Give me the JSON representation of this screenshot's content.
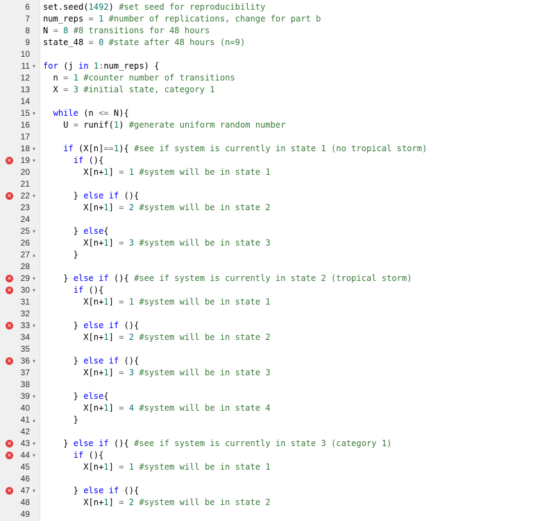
{
  "lines": [
    {
      "n": "6",
      "fold": "",
      "err": false,
      "t": [
        [
          "fn",
          "set.seed("
        ],
        [
          "num",
          "1492"
        ],
        [
          "fn",
          ") "
        ],
        [
          "cm",
          "#set seed for reproducibility"
        ]
      ]
    },
    {
      "n": "7",
      "fold": "",
      "err": false,
      "t": [
        [
          "fn",
          "num_reps "
        ],
        [
          "op",
          "= "
        ],
        [
          "num",
          "1"
        ],
        [
          "fn",
          " "
        ],
        [
          "cm",
          "#number of replications, change for part b"
        ]
      ]
    },
    {
      "n": "8",
      "fold": "",
      "err": false,
      "t": [
        [
          "fn",
          "N "
        ],
        [
          "op",
          "= "
        ],
        [
          "num",
          "8"
        ],
        [
          "fn",
          " "
        ],
        [
          "cm",
          "#8 transitions for 48 hours"
        ]
      ]
    },
    {
      "n": "9",
      "fold": "",
      "err": false,
      "t": [
        [
          "fn",
          "state_48 "
        ],
        [
          "op",
          "= "
        ],
        [
          "num",
          "0"
        ],
        [
          "fn",
          " "
        ],
        [
          "cm",
          "#state after 48 hours (n=9)"
        ]
      ]
    },
    {
      "n": "10",
      "fold": "",
      "err": false,
      "t": []
    },
    {
      "n": "11",
      "fold": "▾",
      "err": false,
      "t": [
        [
          "kw",
          "for"
        ],
        [
          "fn",
          " (j "
        ],
        [
          "kw",
          "in"
        ],
        [
          "fn",
          " "
        ],
        [
          "num",
          "1"
        ],
        [
          "op",
          ":"
        ],
        [
          "fn",
          "num_reps) {"
        ]
      ]
    },
    {
      "n": "12",
      "fold": "",
      "err": false,
      "t": [
        [
          "fn",
          "  n "
        ],
        [
          "op",
          "= "
        ],
        [
          "num",
          "1"
        ],
        [
          "fn",
          " "
        ],
        [
          "cm",
          "#counter number of transitions"
        ]
      ]
    },
    {
      "n": "13",
      "fold": "",
      "err": false,
      "t": [
        [
          "fn",
          "  X "
        ],
        [
          "op",
          "= "
        ],
        [
          "num",
          "3"
        ],
        [
          "fn",
          " "
        ],
        [
          "cm",
          "#initial state, category 1"
        ]
      ]
    },
    {
      "n": "14",
      "fold": "",
      "err": false,
      "t": []
    },
    {
      "n": "15",
      "fold": "▾",
      "err": false,
      "t": [
        [
          "fn",
          "  "
        ],
        [
          "kw",
          "while"
        ],
        [
          "fn",
          " (n "
        ],
        [
          "op",
          "<="
        ],
        [
          "fn",
          " N){"
        ]
      ]
    },
    {
      "n": "16",
      "fold": "",
      "err": false,
      "t": [
        [
          "fn",
          "    U "
        ],
        [
          "op",
          "= "
        ],
        [
          "fn",
          "runif("
        ],
        [
          "num",
          "1"
        ],
        [
          "fn",
          ") "
        ],
        [
          "cm",
          "#generate uniform random number"
        ]
      ]
    },
    {
      "n": "17",
      "fold": "",
      "err": false,
      "t": []
    },
    {
      "n": "18",
      "fold": "▾",
      "err": false,
      "t": [
        [
          "fn",
          "    "
        ],
        [
          "kw",
          "if"
        ],
        [
          "fn",
          " (X[n]"
        ],
        [
          "op",
          "=="
        ],
        [
          "num",
          "1"
        ],
        [
          "fn",
          "){ "
        ],
        [
          "cm",
          "#see if system is currently in state 1 (no tropical storm)"
        ]
      ]
    },
    {
      "n": "19",
      "fold": "▾",
      "err": true,
      "t": [
        [
          "fn",
          "      "
        ],
        [
          "kw",
          "if"
        ],
        [
          "fn",
          " (){"
        ]
      ]
    },
    {
      "n": "20",
      "fold": "",
      "err": false,
      "t": [
        [
          "fn",
          "        X[n+"
        ],
        [
          "num",
          "1"
        ],
        [
          "fn",
          "] "
        ],
        [
          "op",
          "= "
        ],
        [
          "num",
          "1"
        ],
        [
          "fn",
          " "
        ],
        [
          "cm",
          "#system will be in state 1"
        ]
      ]
    },
    {
      "n": "21",
      "fold": "",
      "err": false,
      "t": []
    },
    {
      "n": "22",
      "fold": "▾",
      "err": true,
      "t": [
        [
          "fn",
          "      } "
        ],
        [
          "kw",
          "else if"
        ],
        [
          "fn",
          " (){"
        ]
      ]
    },
    {
      "n": "23",
      "fold": "",
      "err": false,
      "t": [
        [
          "fn",
          "        X[n+"
        ],
        [
          "num",
          "1"
        ],
        [
          "fn",
          "] "
        ],
        [
          "op",
          "= "
        ],
        [
          "num",
          "2"
        ],
        [
          "fn",
          " "
        ],
        [
          "cm",
          "#system will be in state 2"
        ]
      ]
    },
    {
      "n": "24",
      "fold": "",
      "err": false,
      "t": []
    },
    {
      "n": "25",
      "fold": "▾",
      "err": false,
      "t": [
        [
          "fn",
          "      } "
        ],
        [
          "kw",
          "else"
        ],
        [
          "fn",
          "{"
        ]
      ]
    },
    {
      "n": "26",
      "fold": "",
      "err": false,
      "t": [
        [
          "fn",
          "        X[n+"
        ],
        [
          "num",
          "1"
        ],
        [
          "fn",
          "] "
        ],
        [
          "op",
          "= "
        ],
        [
          "num",
          "3"
        ],
        [
          "fn",
          " "
        ],
        [
          "cm",
          "#system will be in state 3"
        ]
      ]
    },
    {
      "n": "27",
      "fold": "▴",
      "err": false,
      "t": [
        [
          "fn",
          "      }"
        ]
      ]
    },
    {
      "n": "28",
      "fold": "",
      "err": false,
      "t": []
    },
    {
      "n": "29",
      "fold": "▾",
      "err": true,
      "t": [
        [
          "fn",
          "    } "
        ],
        [
          "kw",
          "else if"
        ],
        [
          "fn",
          " (){ "
        ],
        [
          "cm",
          "#see if system is currently in state 2 (tropical storm)"
        ]
      ]
    },
    {
      "n": "30",
      "fold": "▾",
      "err": true,
      "t": [
        [
          "fn",
          "      "
        ],
        [
          "kw",
          "if"
        ],
        [
          "fn",
          " (){"
        ]
      ]
    },
    {
      "n": "31",
      "fold": "",
      "err": false,
      "t": [
        [
          "fn",
          "        X[n+"
        ],
        [
          "num",
          "1"
        ],
        [
          "fn",
          "] "
        ],
        [
          "op",
          "= "
        ],
        [
          "num",
          "1"
        ],
        [
          "fn",
          " "
        ],
        [
          "cm",
          "#system will be in state 1"
        ]
      ]
    },
    {
      "n": "32",
      "fold": "",
      "err": false,
      "t": []
    },
    {
      "n": "33",
      "fold": "▾",
      "err": true,
      "t": [
        [
          "fn",
          "      } "
        ],
        [
          "kw",
          "else if"
        ],
        [
          "fn",
          " (){"
        ]
      ]
    },
    {
      "n": "34",
      "fold": "",
      "err": false,
      "t": [
        [
          "fn",
          "        X[n+"
        ],
        [
          "num",
          "1"
        ],
        [
          "fn",
          "] "
        ],
        [
          "op",
          "= "
        ],
        [
          "num",
          "2"
        ],
        [
          "fn",
          " "
        ],
        [
          "cm",
          "#system will be in state 2"
        ]
      ]
    },
    {
      "n": "35",
      "fold": "",
      "err": false,
      "t": []
    },
    {
      "n": "36",
      "fold": "▾",
      "err": true,
      "t": [
        [
          "fn",
          "      } "
        ],
        [
          "kw",
          "else if"
        ],
        [
          "fn",
          " (){"
        ]
      ]
    },
    {
      "n": "37",
      "fold": "",
      "err": false,
      "t": [
        [
          "fn",
          "        X[n+"
        ],
        [
          "num",
          "1"
        ],
        [
          "fn",
          "] "
        ],
        [
          "op",
          "= "
        ],
        [
          "num",
          "3"
        ],
        [
          "fn",
          " "
        ],
        [
          "cm",
          "#system will be in state 3"
        ]
      ]
    },
    {
      "n": "38",
      "fold": "",
      "err": false,
      "t": []
    },
    {
      "n": "39",
      "fold": "▾",
      "err": false,
      "t": [
        [
          "fn",
          "      } "
        ],
        [
          "kw",
          "else"
        ],
        [
          "fn",
          "{"
        ]
      ]
    },
    {
      "n": "40",
      "fold": "",
      "err": false,
      "t": [
        [
          "fn",
          "        X[n+"
        ],
        [
          "num",
          "1"
        ],
        [
          "fn",
          "] "
        ],
        [
          "op",
          "= "
        ],
        [
          "num",
          "4"
        ],
        [
          "fn",
          " "
        ],
        [
          "cm",
          "#system will be in state 4"
        ]
      ]
    },
    {
      "n": "41",
      "fold": "▴",
      "err": false,
      "t": [
        [
          "fn",
          "      }"
        ]
      ]
    },
    {
      "n": "42",
      "fold": "",
      "err": false,
      "t": []
    },
    {
      "n": "43",
      "fold": "▾",
      "err": true,
      "t": [
        [
          "fn",
          "    } "
        ],
        [
          "kw",
          "else if"
        ],
        [
          "fn",
          " (){ "
        ],
        [
          "cm",
          "#see if system is currently in state 3 (category 1)"
        ]
      ]
    },
    {
      "n": "44",
      "fold": "▾",
      "err": true,
      "t": [
        [
          "fn",
          "      "
        ],
        [
          "kw",
          "if"
        ],
        [
          "fn",
          " (){"
        ]
      ]
    },
    {
      "n": "45",
      "fold": "",
      "err": false,
      "t": [
        [
          "fn",
          "        X[n+"
        ],
        [
          "num",
          "1"
        ],
        [
          "fn",
          "] "
        ],
        [
          "op",
          "= "
        ],
        [
          "num",
          "1"
        ],
        [
          "fn",
          " "
        ],
        [
          "cm",
          "#system will be in state 1"
        ]
      ]
    },
    {
      "n": "46",
      "fold": "",
      "err": false,
      "t": []
    },
    {
      "n": "47",
      "fold": "▾",
      "err": true,
      "t": [
        [
          "fn",
          "      } "
        ],
        [
          "kw",
          "else if"
        ],
        [
          "fn",
          " (){"
        ]
      ]
    },
    {
      "n": "48",
      "fold": "",
      "err": false,
      "t": [
        [
          "fn",
          "        X[n+"
        ],
        [
          "num",
          "1"
        ],
        [
          "fn",
          "] "
        ],
        [
          "op",
          "= "
        ],
        [
          "num",
          "2"
        ],
        [
          "fn",
          " "
        ],
        [
          "cm",
          "#system will be in state 2"
        ]
      ]
    },
    {
      "n": "49",
      "fold": "",
      "err": false,
      "t": []
    }
  ],
  "icons": {
    "error": "error-x-icon",
    "fold_open": "fold-open-icon",
    "fold_close": "fold-close-icon"
  },
  "colors": {
    "comment": "#3a7a3a",
    "keyword": "#0000ff",
    "number": "#0d7a6e",
    "error": "#e23a3a"
  }
}
